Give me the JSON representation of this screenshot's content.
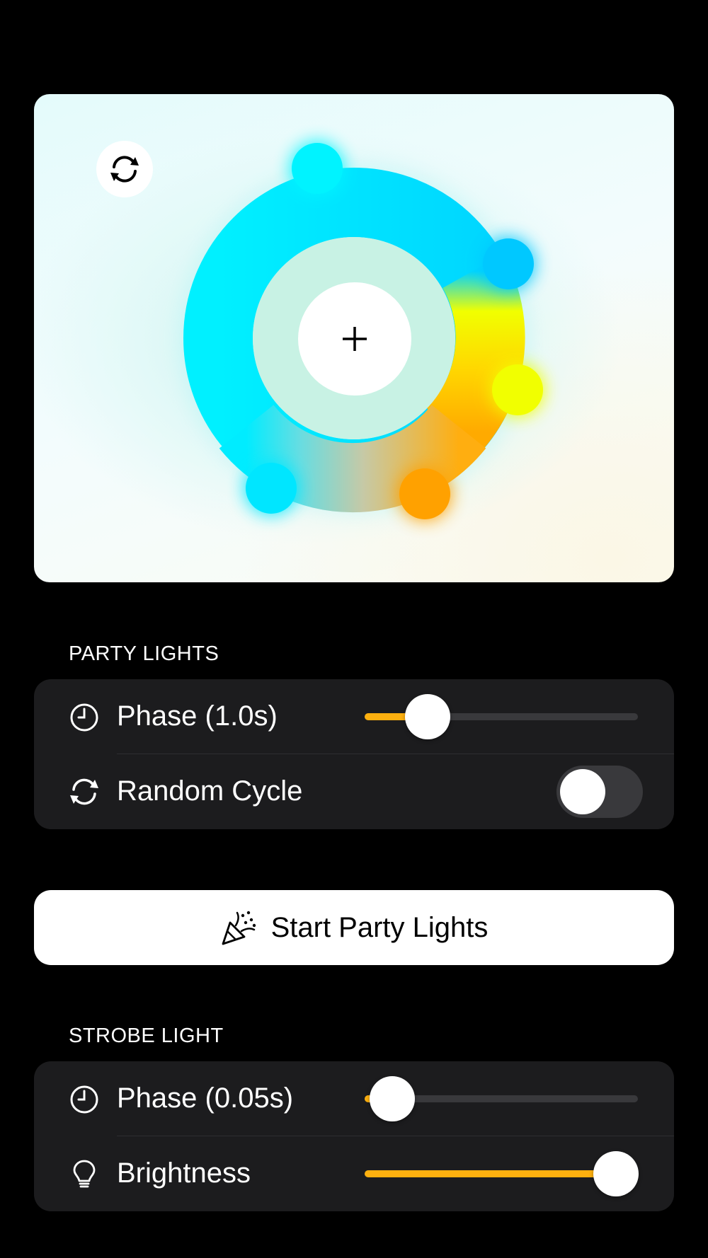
{
  "color_wheel": {
    "cycle_icon": "arrow-cycle-icon",
    "add_icon": "plus-icon",
    "segment_colors": [
      "#00f0ff",
      "#00d8ff",
      "#f3ff00",
      "#ffc300",
      "#ff9f00",
      "#00e8ff"
    ]
  },
  "party_lights": {
    "header": "PARTY LIGHTS",
    "phase": {
      "icon": "clock-icon",
      "label": "Phase (1.0s)",
      "value": 0.23
    },
    "random_cycle": {
      "icon": "arrow-cycle-icon",
      "label": "Random Cycle",
      "on": false
    }
  },
  "start_button": {
    "icon": "party-popper-icon",
    "label": "Start Party Lights"
  },
  "strobe_light": {
    "header": "STROBE LIGHT",
    "phase": {
      "icon": "clock-icon",
      "label": "Phase (0.05s)",
      "value": 0.1
    },
    "brightness": {
      "icon": "lightbulb-icon",
      "label": "Brightness",
      "value": 0.92
    }
  },
  "colors": {
    "accent": "#fdb00f",
    "group_bg": "#1c1c1e",
    "background": "#000000"
  }
}
